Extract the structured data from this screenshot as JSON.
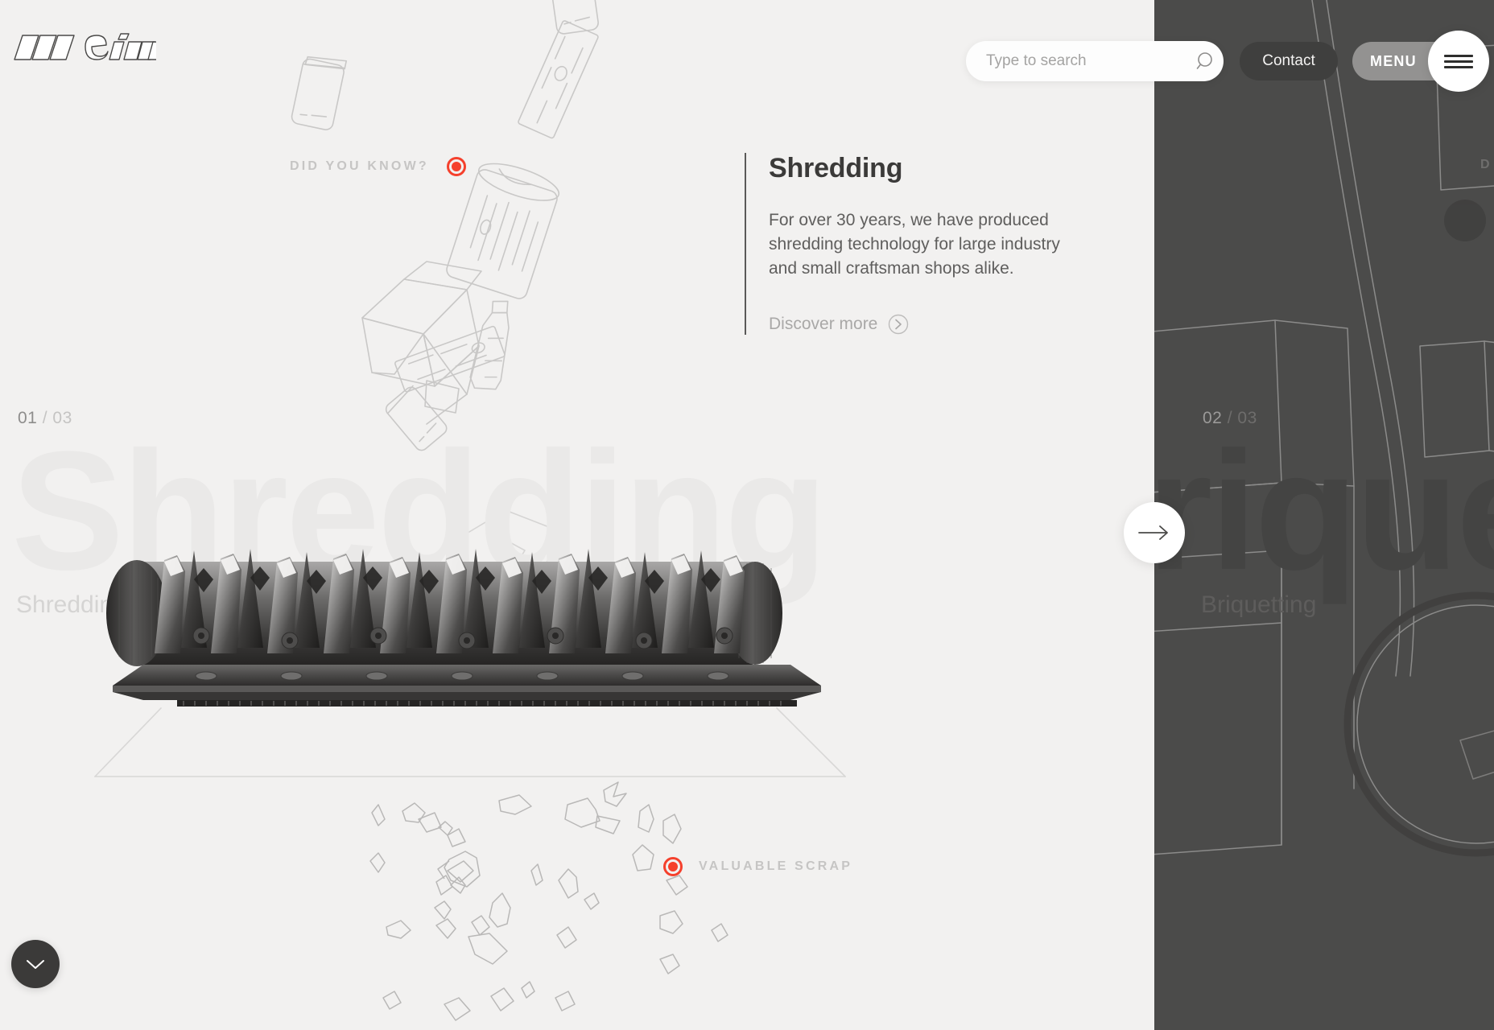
{
  "brand": {
    "name": "WEIMA"
  },
  "header": {
    "search": {
      "placeholder": "Type to search",
      "value": "",
      "icon": "search-icon"
    },
    "contact_label": "Contact",
    "menu_label": "MENU",
    "burger_icon": "hamburger-icon"
  },
  "slider": {
    "current_slide": {
      "eyebrow": "DID YOU KNOW?",
      "index_current": "01",
      "index_separator": "/",
      "index_total": "03",
      "ghost_word": "Shredding",
      "name": "Shredding",
      "title": "Shredding",
      "body": "For over 30 years, we have produced shredding technology for large industry and small craftsman shops alike.",
      "cta_label": "Discover more",
      "cta_icon": "circle-arrow-right-icon",
      "hotspot_label": "VALUABLE SCRAP"
    },
    "next_slide": {
      "index_current": "02",
      "index_separator": "/",
      "index_total": "03",
      "ghost_word": "Briquetting",
      "name": "Briquetting",
      "eyebrow": "D"
    },
    "next_button_icon": "arrow-right-icon",
    "scroll_down_icon": "chevron-down-icon"
  },
  "colors": {
    "accent": "#f5402c",
    "light_bg": "#f2f1f0",
    "dark_bg": "#4b4b4a",
    "text_dark": "#3b3a39",
    "text_muted": "#5f5e5d",
    "text_faint": "#c6c5c4",
    "ghost_light": "#eae9e8",
    "ghost_dark": "#444443"
  }
}
